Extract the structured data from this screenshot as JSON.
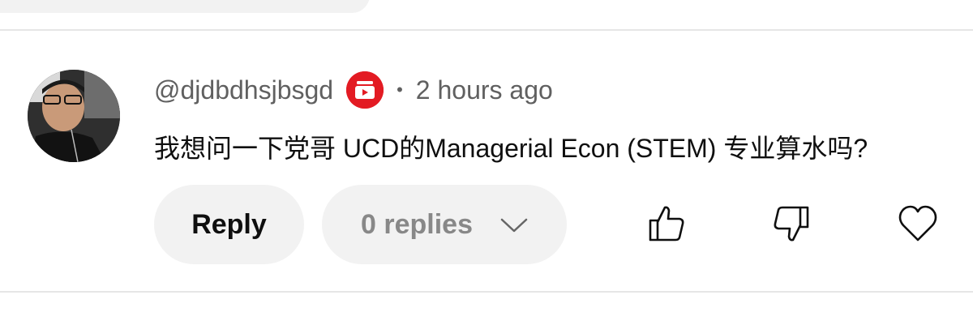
{
  "comment": {
    "username": "@djdbdhsjbsgd",
    "separator": "•",
    "timestamp": "2 hours ago",
    "text": "我想问一下党哥 UCD的Managerial Econ (STEM) 专业算水吗?",
    "creator_badge_icon": "creator-badge-icon"
  },
  "actions": {
    "reply_label": "Reply",
    "replies_label": "0 replies",
    "like_icon": "thumbs-up-icon",
    "dislike_icon": "thumbs-down-icon",
    "heart_icon": "heart-icon",
    "expand_icon": "chevron-down-icon"
  },
  "colors": {
    "badge": "#e31b23",
    "button_bg": "#f2f2f2",
    "meta_text": "#606060"
  }
}
